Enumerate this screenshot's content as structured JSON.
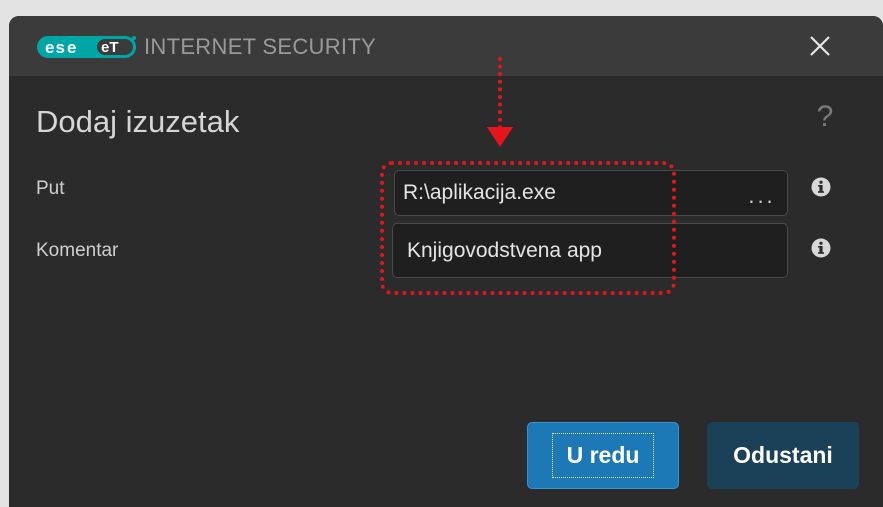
{
  "app": {
    "logo_text": "eset",
    "name": "INTERNET SECURITY"
  },
  "dialog": {
    "title": "Dodaj izuzetak",
    "help_symbol": "?",
    "close_symbol": "✕"
  },
  "form": {
    "path": {
      "label": "Put",
      "value": "R:\\aplikacija.exe",
      "browse_label": "..."
    },
    "comment": {
      "label": "Komentar",
      "value": "Knjigovodstvena app"
    }
  },
  "buttons": {
    "ok_label": "U redu",
    "cancel_label": "Odustani"
  },
  "colors": {
    "accent": "#1c79b6",
    "highlight": "#e8141b",
    "logo": "#00a6a6"
  },
  "icons": [
    "eset-logo-icon",
    "close-icon",
    "help-icon",
    "info-icon",
    "arrow-down-icon"
  ]
}
